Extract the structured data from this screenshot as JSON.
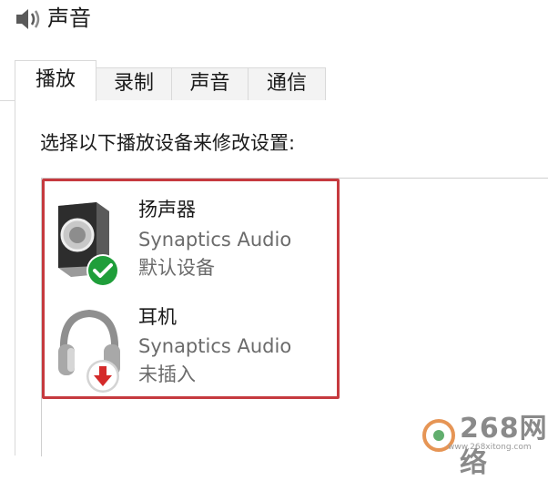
{
  "window": {
    "title": "声音",
    "icon": "speaker-icon"
  },
  "tabs": [
    {
      "label": "播放",
      "active": true
    },
    {
      "label": "录制",
      "active": false
    },
    {
      "label": "声音",
      "active": false
    },
    {
      "label": "通信",
      "active": false
    }
  ],
  "playback": {
    "instruction": "选择以下播放设备来修改设置:",
    "devices": [
      {
        "name": "扬声器",
        "driver": "Synaptics Audio",
        "status": "默认设备",
        "icon": "speaker-icon",
        "badge": "checkmark-icon"
      },
      {
        "name": "耳机",
        "driver": "Synaptics Audio",
        "status": "未插入",
        "icon": "headphones-icon",
        "badge": "down-arrow-icon"
      }
    ]
  },
  "colors": {
    "highlight": "#c63a3f",
    "check_badge": "#1f9e3a",
    "unplugged_badge": "#d42a2a"
  },
  "watermark": {
    "text": "268网络",
    "small": "www.268xitong.com"
  }
}
